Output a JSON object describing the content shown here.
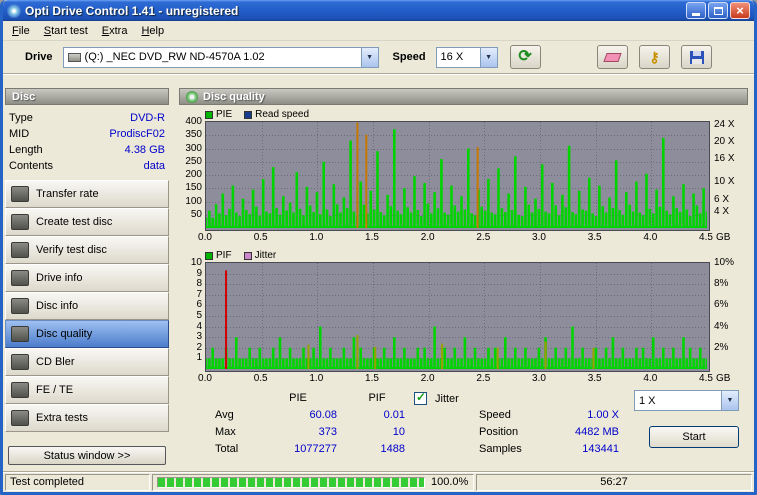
{
  "window": {
    "title": "Opti Drive Control 1.41 - unregistered"
  },
  "menu": {
    "items": [
      "File",
      "Start test",
      "Extra",
      "Help"
    ]
  },
  "toolbar": {
    "drive_label": "Drive",
    "drive_value": "(Q:)  _NEC DVD_RW ND-4570A 1.02",
    "speed_label": "Speed",
    "speed_value": "16 X"
  },
  "sidebar": {
    "header": "Disc",
    "info": [
      {
        "label": "Type",
        "value": "DVD-R"
      },
      {
        "label": "MID",
        "value": "ProdiscF02"
      },
      {
        "label": "Length",
        "value": "4.38 GB"
      },
      {
        "label": "Contents",
        "value": "data"
      }
    ],
    "items": [
      {
        "label": "Transfer rate"
      },
      {
        "label": "Create test disc"
      },
      {
        "label": "Verify test disc"
      },
      {
        "label": "Drive info"
      },
      {
        "label": "Disc info"
      },
      {
        "label": "Disc quality",
        "selected": true
      },
      {
        "label": "CD Bler"
      },
      {
        "label": "FE / TE"
      },
      {
        "label": "Extra tests"
      }
    ],
    "status_button": "Status window >>"
  },
  "main": {
    "header": "Disc quality"
  },
  "stats": {
    "col_pie": "PIE",
    "col_pif": "PIF",
    "rows": [
      {
        "label": "Avg",
        "pie": "60.08",
        "pif": "0.01"
      },
      {
        "label": "Max",
        "pie": "373",
        "pif": "10"
      },
      {
        "label": "Total",
        "pie": "1077277",
        "pif": "1488"
      }
    ],
    "jitter_label": "Jitter",
    "speed_label": "Speed",
    "speed_value": "1.00 X",
    "position_label": "Position",
    "position_value": "4482 MB",
    "samples_label": "Samples",
    "samples_value": "143441",
    "speed_select": "1 X",
    "start_label": "Start"
  },
  "statusbar": {
    "status": "Test completed",
    "progress": "100.0%",
    "time": "56:27"
  },
  "chart_data": [
    {
      "type": "area",
      "legend": [
        {
          "label": "PIE",
          "color": "#00b400"
        },
        {
          "label": "Read speed",
          "color": "#1a3c8c"
        }
      ],
      "x": {
        "min": 0,
        "max": 4.5,
        "ticks": [
          "0.0",
          "0.5",
          "1.0",
          "1.5",
          "2.0",
          "2.5",
          "3.0",
          "3.5",
          "4.0",
          "4.5"
        ],
        "unit": "GB"
      },
      "y_left": {
        "min": 0,
        "max": 400,
        "ticks": [
          400,
          350,
          300,
          250,
          200,
          150,
          100,
          50
        ]
      },
      "y_right": {
        "ticks": [
          "24 X",
          "20 X",
          "16 X",
          "10 X",
          "6 X",
          "4 X"
        ],
        "pos": [
          3,
          19,
          35,
          57,
          74,
          85
        ]
      },
      "series": [
        {
          "name": "PIE",
          "color": "#00d400",
          "values": [
            40,
            65,
            38,
            90,
            55,
            130,
            48,
            72,
            160,
            58,
            44,
            110,
            68,
            52,
            145,
            80,
            47,
            185,
            62,
            55,
            230,
            75,
            50,
            120,
            66,
            95,
            58,
            210,
            72,
            48,
            155,
            85,
            60,
            135,
            52,
            250,
            70,
            45,
            165,
            90,
            58,
            115,
            75,
            330,
            62,
            50,
            175,
            88,
            55,
            140,
            70,
            290,
            60,
            48,
            125,
            82,
            373,
            65,
            52,
            150,
            78,
            58,
            195,
            68,
            45,
            170,
            92,
            55,
            135,
            74,
            260,
            58,
            50,
            160,
            85,
            62,
            120,
            70,
            300,
            55,
            48,
            145,
            80,
            65,
            185,
            58,
            52,
            225,
            75,
            60,
            130,
            68,
            270,
            50,
            45,
            155,
            88,
            58,
            110,
            72,
            240,
            62,
            55,
            170,
            85,
            48,
            125,
            78,
            310,
            60,
            52,
            140,
            70,
            65,
            190,
            55,
            45,
            160,
            82,
            58,
            115,
            75,
            255,
            68,
            50,
            135,
            88,
            62,
            175,
            58,
            48,
            205,
            72,
            55,
            145,
            80,
            340,
            65,
            52,
            120,
            75,
            60,
            165,
            70,
            45,
            130,
            85,
            55,
            150,
            62
          ]
        }
      ],
      "accent_spikes": {
        "color": "#c87800",
        "points": [
          [
            1.36,
            398
          ],
          [
            1.44,
            352
          ],
          [
            2.44,
            305
          ]
        ]
      }
    },
    {
      "type": "area",
      "legend": [
        {
          "label": "PIF",
          "color": "#00b400"
        },
        {
          "label": "Jitter",
          "color": "#cc88cc"
        }
      ],
      "x": {
        "min": 0,
        "max": 4.5,
        "ticks": [
          "0.0",
          "0.5",
          "1.0",
          "1.5",
          "2.0",
          "2.5",
          "3.0",
          "3.5",
          "4.0",
          "4.5"
        ],
        "unit": "GB"
      },
      "y_left": {
        "min": 0,
        "max": 10,
        "ticks": [
          10,
          9,
          8,
          7,
          6,
          5,
          4,
          3,
          2,
          1
        ]
      },
      "y_right": {
        "ticks": [
          "10%",
          "8%",
          "6%",
          "4%",
          "2%"
        ],
        "pos": [
          0,
          20,
          40,
          60,
          80
        ]
      },
      "series": [
        {
          "name": "PIF",
          "color": "#00d400",
          "values": [
            1,
            1,
            2,
            1,
            1,
            1,
            2,
            1,
            1,
            3,
            1,
            1,
            1,
            2,
            1,
            1,
            2,
            1,
            1,
            1,
            2,
            1,
            3,
            1,
            1,
            2,
            1,
            1,
            1,
            2,
            1,
            1,
            2,
            1,
            4,
            1,
            1,
            2,
            1,
            1,
            1,
            2,
            1,
            1,
            3,
            1,
            2,
            1,
            1,
            1,
            2,
            1,
            1,
            2,
            1,
            1,
            3,
            1,
            1,
            2,
            1,
            1,
            1,
            2,
            1,
            2,
            1,
            1,
            4,
            1,
            1,
            2,
            1,
            1,
            2,
            1,
            1,
            3,
            1,
            1,
            2,
            1,
            1,
            1,
            2,
            1,
            2,
            1,
            1,
            3,
            1,
            1,
            2,
            1,
            1,
            2,
            1,
            1,
            1,
            2,
            1,
            3,
            1,
            1,
            2,
            1,
            1,
            2,
            1,
            4,
            1,
            1,
            2,
            1,
            1,
            1,
            2,
            1,
            1,
            2,
            1,
            3,
            1,
            1,
            2,
            1,
            1,
            1,
            2,
            1,
            2,
            1,
            1,
            3,
            1,
            1,
            2,
            1,
            1,
            2,
            1,
            1,
            3,
            1,
            2,
            1,
            1,
            2,
            1,
            1
          ]
        }
      ],
      "accent_spikes": {
        "color": "#9aa000",
        "points": [
          [
            0.92,
            2.3
          ],
          [
            1.36,
            3.2
          ],
          [
            1.52,
            2.1
          ],
          [
            2.12,
            2.4
          ],
          [
            2.62,
            2.0
          ],
          [
            3.05,
            2.6
          ],
          [
            3.48,
            2.0
          ]
        ]
      },
      "marker_spikes": {
        "color": "#d40000",
        "points": [
          [
            0.18,
            9.3
          ]
        ]
      }
    }
  ]
}
